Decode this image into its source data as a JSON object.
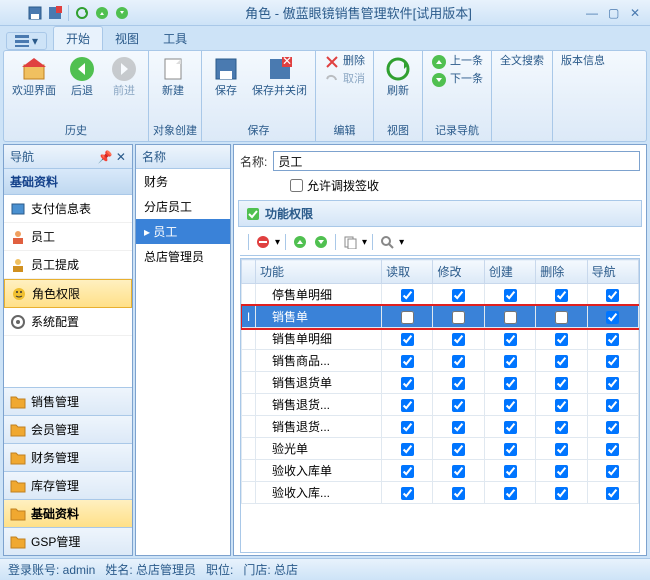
{
  "title": "角色 - 傲蓝眼镜销售管理软件[试用版本]",
  "tabs": {
    "start": "开始",
    "view": "视图",
    "tools": "工具"
  },
  "ribbon": {
    "welcome": "欢迎界面",
    "back": "后退",
    "forward": "前进",
    "history": "历史",
    "new": "新建",
    "objcreate": "对象创建",
    "save": "保存",
    "saveclose": "保存并关闭",
    "del": "删除",
    "undo": "取消",
    "savegrp": "保存",
    "editgrp": "编辑",
    "refresh": "刷新",
    "viewgrp": "视图",
    "prev": "上一条",
    "next": "下一条",
    "recnav": "记录导航",
    "fullsearch": "全文搜索",
    "version": "版本信息"
  },
  "nav": {
    "title": "导航",
    "section": "基础资料",
    "items": [
      "支付信息表",
      "员工",
      "员工提成",
      "角色权限",
      "系统配置"
    ],
    "cats": [
      "销售管理",
      "会员管理",
      "财务管理",
      "库存管理",
      "基础资料",
      "GSP管理"
    ]
  },
  "mid": {
    "head": "名称",
    "items": [
      "财务",
      "分店员工",
      "员工",
      "总店管理员"
    ]
  },
  "form": {
    "name_label": "名称:",
    "name_value": "员工",
    "chk": "允许调拨签收",
    "perm": "功能权限"
  },
  "grid": {
    "cols": [
      "功能",
      "读取",
      "修改",
      "创建",
      "删除",
      "导航"
    ],
    "rows": [
      {
        "fn": "停售单明细",
        "c": [
          true,
          true,
          true,
          true,
          true
        ]
      },
      {
        "fn": "销售单",
        "c": [
          false,
          false,
          false,
          false,
          true
        ],
        "sel": true,
        "hl": true
      },
      {
        "fn": "销售单明细",
        "c": [
          true,
          true,
          true,
          true,
          true
        ]
      },
      {
        "fn": "销售商品...",
        "c": [
          true,
          true,
          true,
          true,
          true
        ]
      },
      {
        "fn": "销售退货单",
        "c": [
          true,
          true,
          true,
          true,
          true
        ]
      },
      {
        "fn": "销售退货...",
        "c": [
          true,
          true,
          true,
          true,
          true
        ]
      },
      {
        "fn": "销售退货...",
        "c": [
          true,
          true,
          true,
          true,
          true
        ]
      },
      {
        "fn": "验光单",
        "c": [
          true,
          true,
          true,
          true,
          true
        ]
      },
      {
        "fn": "验收入库单",
        "c": [
          true,
          true,
          true,
          true,
          true
        ]
      },
      {
        "fn": "验收入库...",
        "c": [
          true,
          true,
          true,
          true,
          true
        ]
      }
    ]
  },
  "status": {
    "acct": "登录账号: admin",
    "name": "姓名: 总店管理员",
    "pos": "职位:",
    "store": "门店: 总店"
  }
}
